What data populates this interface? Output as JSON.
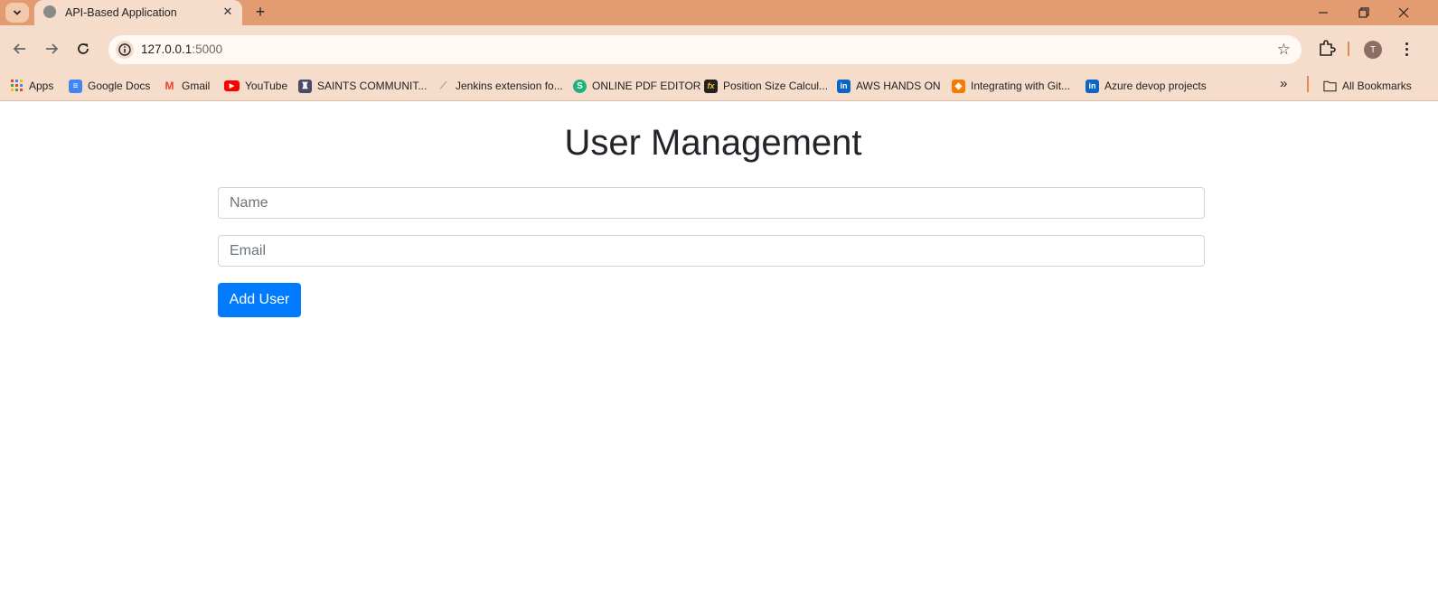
{
  "browser": {
    "tab_title": "API-Based Application",
    "url_host": "127.0.0.1",
    "url_port": ":5000",
    "avatar_initial": "T",
    "frame_color": "#e39b72",
    "toolbar_color": "#f6dccb"
  },
  "bookmarks": [
    {
      "label": "Apps",
      "icon": "apps-grid-icon"
    },
    {
      "label": "Google Docs",
      "icon": "google-docs-icon"
    },
    {
      "label": "Gmail",
      "icon": "gmail-icon"
    },
    {
      "label": "YouTube",
      "icon": "youtube-icon"
    },
    {
      "label": "SAINTS COMMUNIT...",
      "icon": "saints-icon"
    },
    {
      "label": "Jenkins extension fo...",
      "icon": "jenkins-icon"
    },
    {
      "label": "ONLINE PDF EDITOR",
      "icon": "pdf-editor-icon"
    },
    {
      "label": "Position Size Calcul...",
      "icon": "fx-icon"
    },
    {
      "label": "AWS HANDS ON",
      "icon": "linkedin-icon"
    },
    {
      "label": "Integrating with Git...",
      "icon": "package-icon"
    },
    {
      "label": "Azure devop projects",
      "icon": "linkedin-icon"
    }
  ],
  "bookmarks_all_label": "All Bookmarks",
  "page": {
    "title": "User Management",
    "name_placeholder": "Name",
    "email_placeholder": "Email",
    "add_button_label": "Add User",
    "accent_color": "#007bff"
  }
}
